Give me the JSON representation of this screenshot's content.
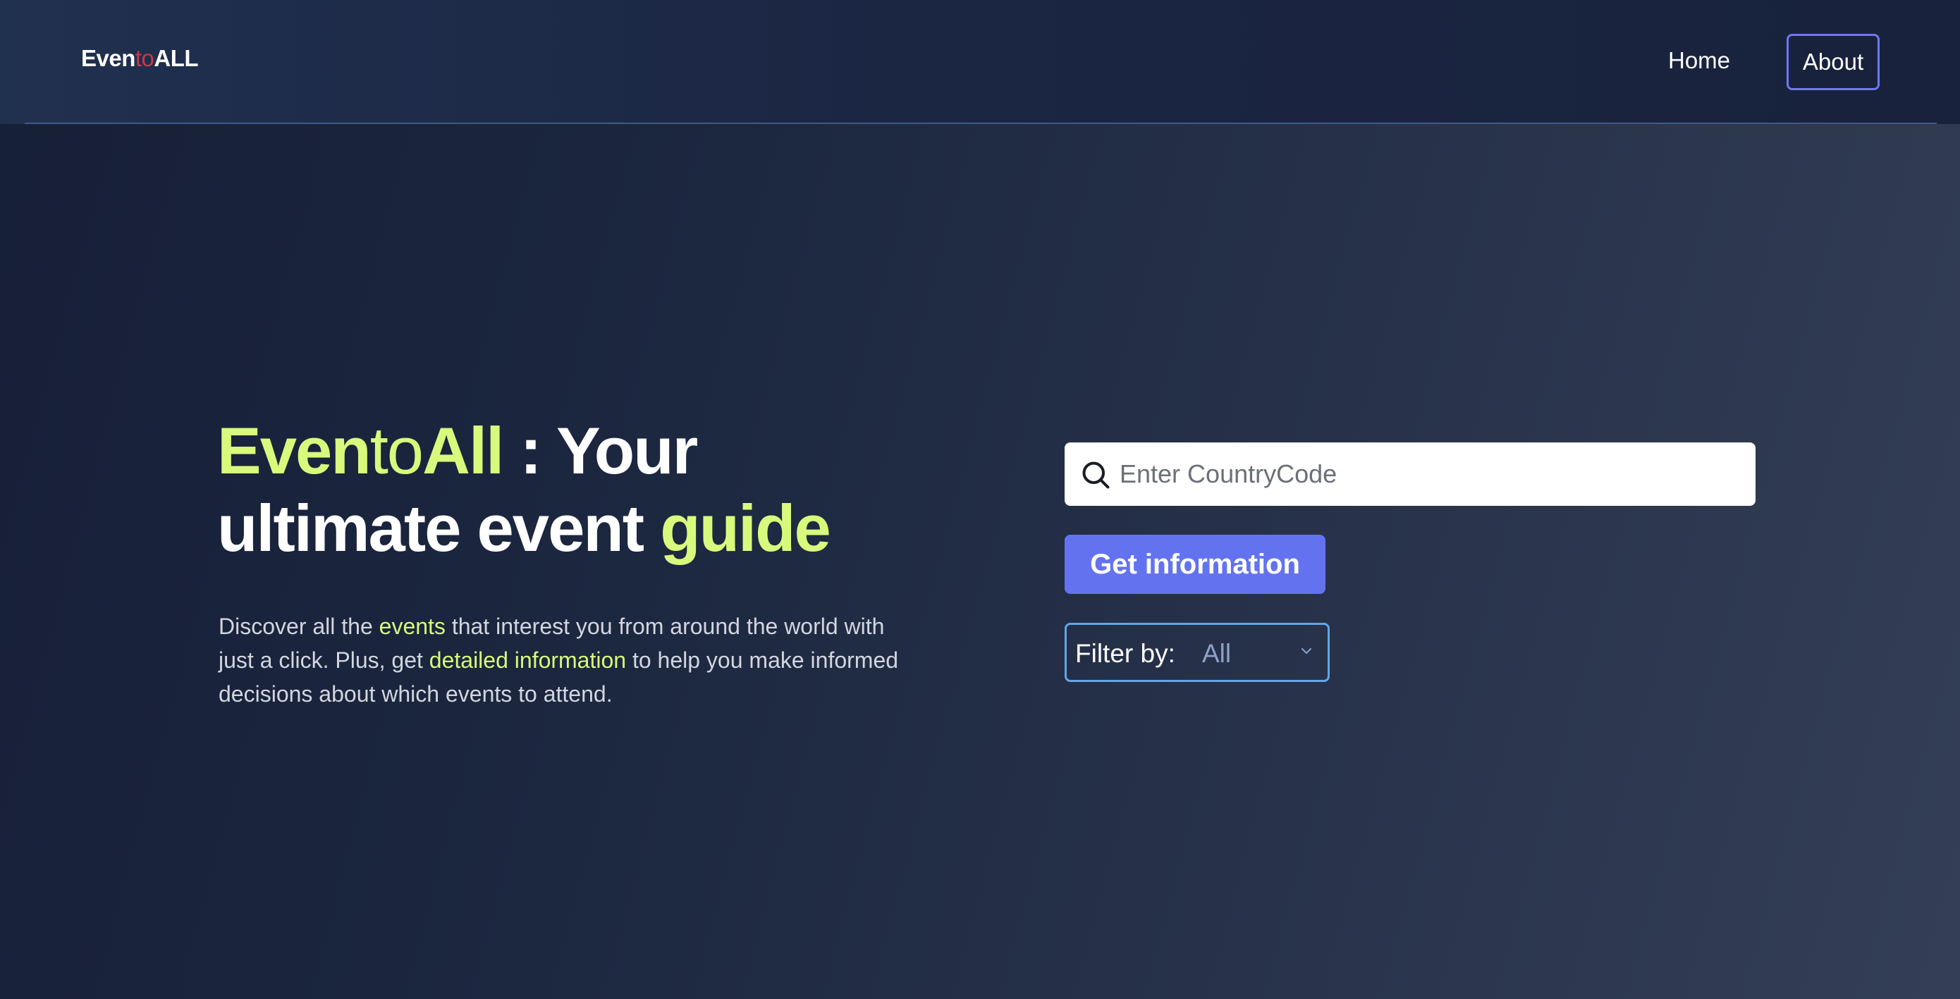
{
  "nav": {
    "logo": {
      "part1": "Even",
      "part2": "to",
      "part3": "ALL"
    },
    "home_label": "Home",
    "about_label": "About"
  },
  "hero": {
    "title": {
      "brand1": "Even",
      "brand2": "to",
      "brand3": "All",
      "rest1": " : Your",
      "line2": "ultimate event ",
      "highlight": "guide"
    },
    "description": {
      "t1": "Discover all the ",
      "h1": "events",
      "t2": " that interest you from around the world with just a click. Plus, get ",
      "h2": "detailed information",
      "t3": " to help you make informed decisions about which events to attend."
    }
  },
  "search": {
    "placeholder": "Enter CountryCode",
    "value": "",
    "icon": "search-icon"
  },
  "actions": {
    "get_info_label": "Get information"
  },
  "filter": {
    "label": "Filter by:",
    "selected": "All",
    "icon": "chevron-down-icon"
  },
  "colors": {
    "accent_green": "#d8f97c",
    "button_blue": "#6373f0",
    "filter_border": "#62a6e6",
    "about_border": "#6e78f0",
    "logo_mid": "#c93a4a"
  }
}
